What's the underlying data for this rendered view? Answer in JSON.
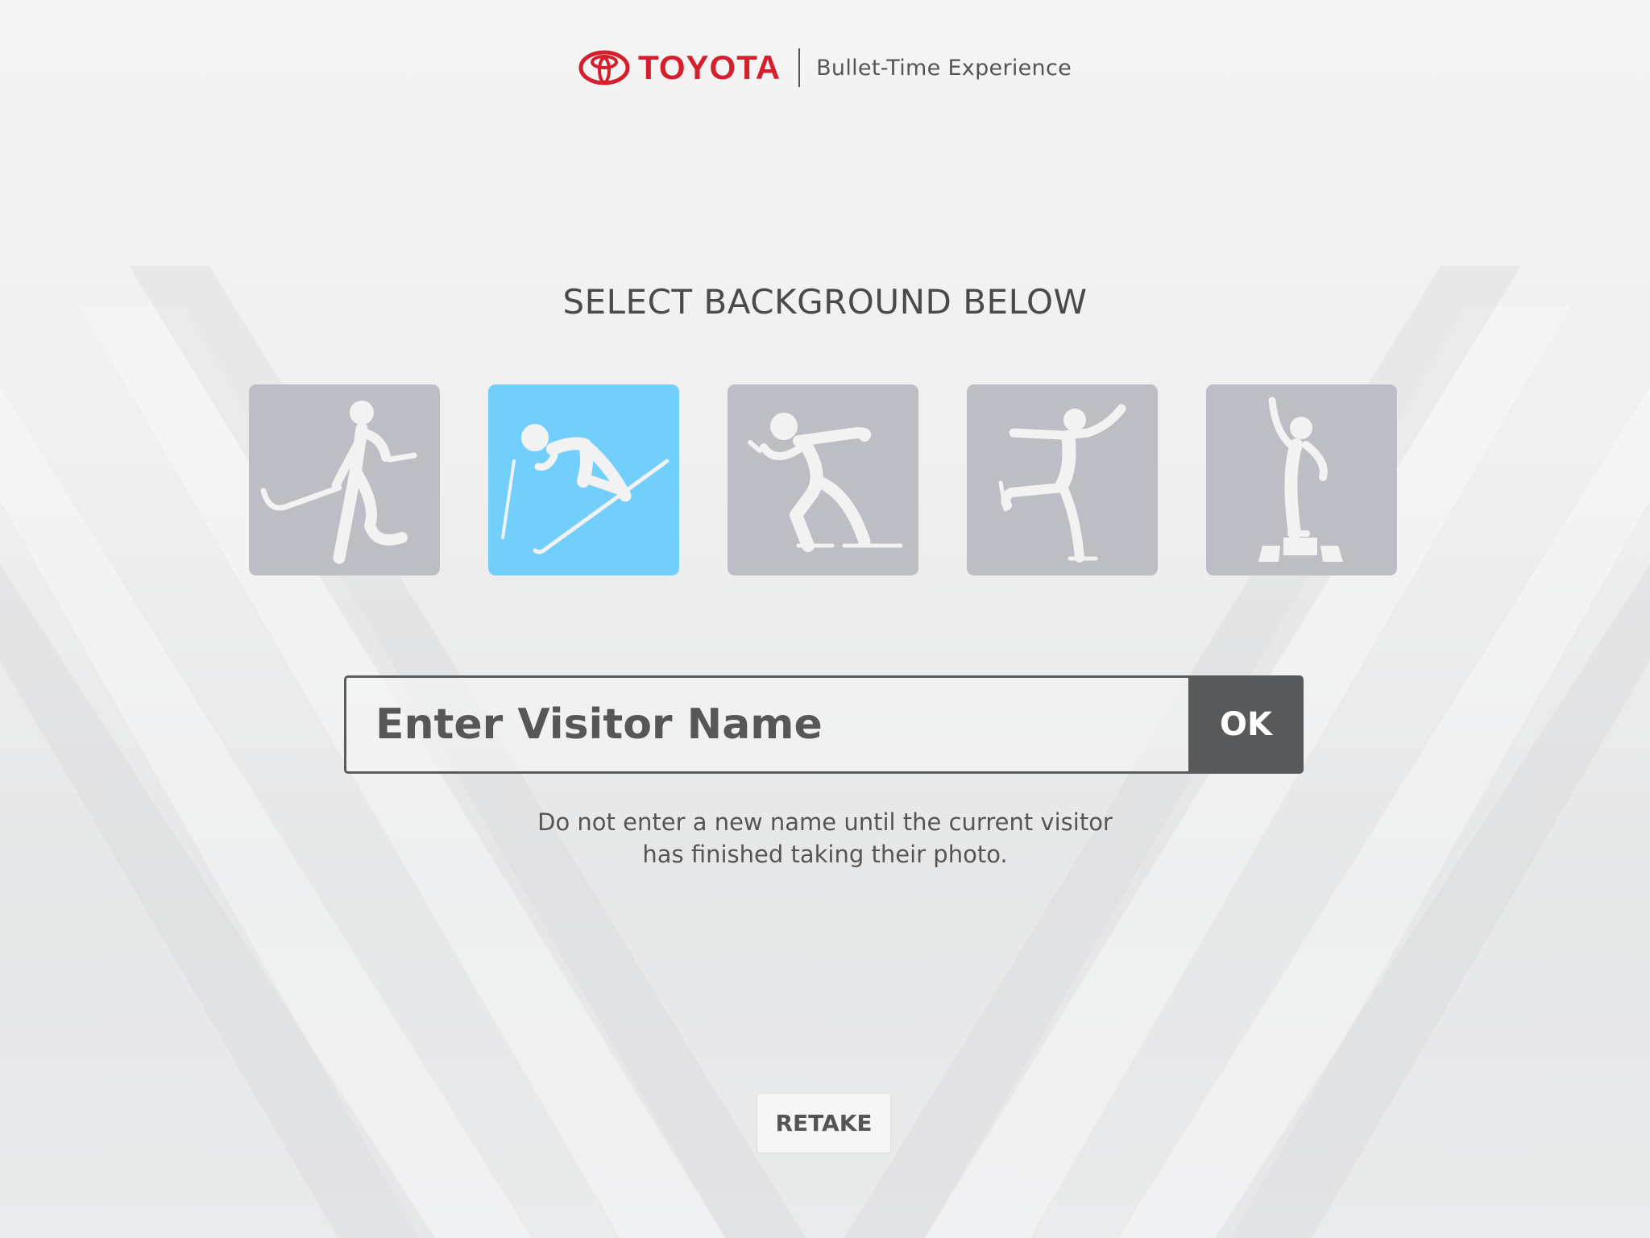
{
  "header": {
    "brand": "TOYOTA",
    "subtitle": "Bullet-Time Experience"
  },
  "heading": "SELECT BACKGROUND BELOW",
  "backgrounds": [
    {
      "icon": "ice-hockey-icon",
      "selected": false
    },
    {
      "icon": "alpine-skiing-icon",
      "selected": true
    },
    {
      "icon": "speed-skating-icon",
      "selected": false
    },
    {
      "icon": "figure-skating-icon",
      "selected": false
    },
    {
      "icon": "podium-icon",
      "selected": false
    }
  ],
  "visitor": {
    "placeholder": "Enter Visitor Name",
    "value": "",
    "ok_label": "OK"
  },
  "note": {
    "line1": "Do not enter a new name until the current visitor",
    "line2": "has finished taking their photo."
  },
  "retake_label": "RETAKE",
  "colors": {
    "brand_red": "#d61f2c",
    "tile_default": "#bcbec3",
    "tile_selected": "#72cffb",
    "ok_button": "#58595b"
  }
}
